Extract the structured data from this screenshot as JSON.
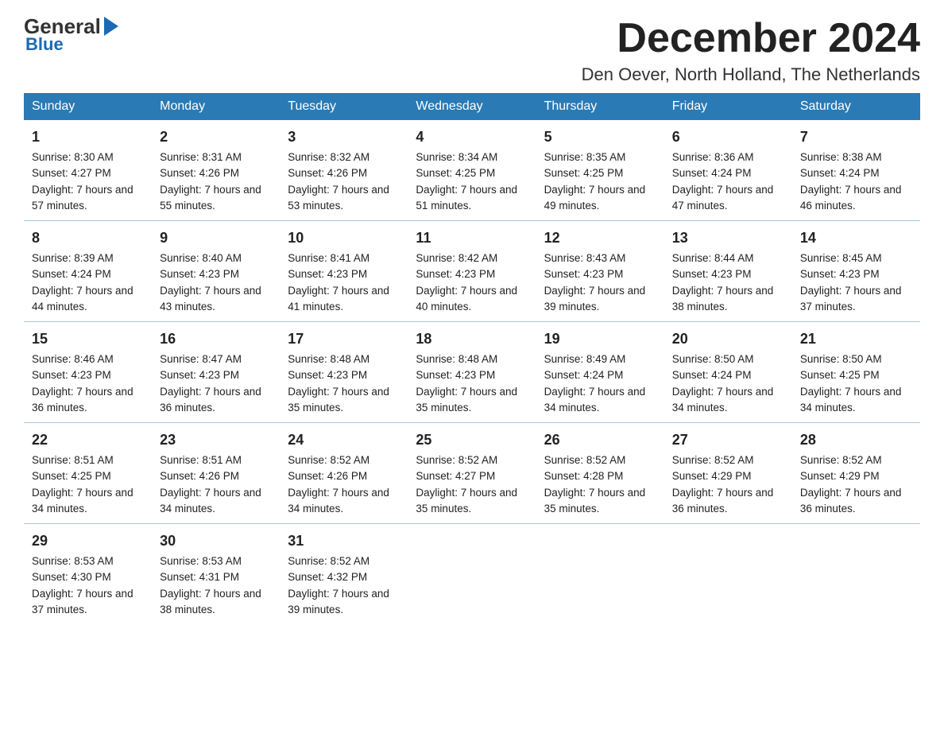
{
  "logo": {
    "text1": "General",
    "text2": "Blue"
  },
  "title": "December 2024",
  "subtitle": "Den Oever, North Holland, The Netherlands",
  "headers": [
    "Sunday",
    "Monday",
    "Tuesday",
    "Wednesday",
    "Thursday",
    "Friday",
    "Saturday"
  ],
  "weeks": [
    [
      {
        "day": "1",
        "sunrise": "8:30 AM",
        "sunset": "4:27 PM",
        "daylight": "7 hours and 57 minutes."
      },
      {
        "day": "2",
        "sunrise": "8:31 AM",
        "sunset": "4:26 PM",
        "daylight": "7 hours and 55 minutes."
      },
      {
        "day": "3",
        "sunrise": "8:32 AM",
        "sunset": "4:26 PM",
        "daylight": "7 hours and 53 minutes."
      },
      {
        "day": "4",
        "sunrise": "8:34 AM",
        "sunset": "4:25 PM",
        "daylight": "7 hours and 51 minutes."
      },
      {
        "day": "5",
        "sunrise": "8:35 AM",
        "sunset": "4:25 PM",
        "daylight": "7 hours and 49 minutes."
      },
      {
        "day": "6",
        "sunrise": "8:36 AM",
        "sunset": "4:24 PM",
        "daylight": "7 hours and 47 minutes."
      },
      {
        "day": "7",
        "sunrise": "8:38 AM",
        "sunset": "4:24 PM",
        "daylight": "7 hours and 46 minutes."
      }
    ],
    [
      {
        "day": "8",
        "sunrise": "8:39 AM",
        "sunset": "4:24 PM",
        "daylight": "7 hours and 44 minutes."
      },
      {
        "day": "9",
        "sunrise": "8:40 AM",
        "sunset": "4:23 PM",
        "daylight": "7 hours and 43 minutes."
      },
      {
        "day": "10",
        "sunrise": "8:41 AM",
        "sunset": "4:23 PM",
        "daylight": "7 hours and 41 minutes."
      },
      {
        "day": "11",
        "sunrise": "8:42 AM",
        "sunset": "4:23 PM",
        "daylight": "7 hours and 40 minutes."
      },
      {
        "day": "12",
        "sunrise": "8:43 AM",
        "sunset": "4:23 PM",
        "daylight": "7 hours and 39 minutes."
      },
      {
        "day": "13",
        "sunrise": "8:44 AM",
        "sunset": "4:23 PM",
        "daylight": "7 hours and 38 minutes."
      },
      {
        "day": "14",
        "sunrise": "8:45 AM",
        "sunset": "4:23 PM",
        "daylight": "7 hours and 37 minutes."
      }
    ],
    [
      {
        "day": "15",
        "sunrise": "8:46 AM",
        "sunset": "4:23 PM",
        "daylight": "7 hours and 36 minutes."
      },
      {
        "day": "16",
        "sunrise": "8:47 AM",
        "sunset": "4:23 PM",
        "daylight": "7 hours and 36 minutes."
      },
      {
        "day": "17",
        "sunrise": "8:48 AM",
        "sunset": "4:23 PM",
        "daylight": "7 hours and 35 minutes."
      },
      {
        "day": "18",
        "sunrise": "8:48 AM",
        "sunset": "4:23 PM",
        "daylight": "7 hours and 35 minutes."
      },
      {
        "day": "19",
        "sunrise": "8:49 AM",
        "sunset": "4:24 PM",
        "daylight": "7 hours and 34 minutes."
      },
      {
        "day": "20",
        "sunrise": "8:50 AM",
        "sunset": "4:24 PM",
        "daylight": "7 hours and 34 minutes."
      },
      {
        "day": "21",
        "sunrise": "8:50 AM",
        "sunset": "4:25 PM",
        "daylight": "7 hours and 34 minutes."
      }
    ],
    [
      {
        "day": "22",
        "sunrise": "8:51 AM",
        "sunset": "4:25 PM",
        "daylight": "7 hours and 34 minutes."
      },
      {
        "day": "23",
        "sunrise": "8:51 AM",
        "sunset": "4:26 PM",
        "daylight": "7 hours and 34 minutes."
      },
      {
        "day": "24",
        "sunrise": "8:52 AM",
        "sunset": "4:26 PM",
        "daylight": "7 hours and 34 minutes."
      },
      {
        "day": "25",
        "sunrise": "8:52 AM",
        "sunset": "4:27 PM",
        "daylight": "7 hours and 35 minutes."
      },
      {
        "day": "26",
        "sunrise": "8:52 AM",
        "sunset": "4:28 PM",
        "daylight": "7 hours and 35 minutes."
      },
      {
        "day": "27",
        "sunrise": "8:52 AM",
        "sunset": "4:29 PM",
        "daylight": "7 hours and 36 minutes."
      },
      {
        "day": "28",
        "sunrise": "8:52 AM",
        "sunset": "4:29 PM",
        "daylight": "7 hours and 36 minutes."
      }
    ],
    [
      {
        "day": "29",
        "sunrise": "8:53 AM",
        "sunset": "4:30 PM",
        "daylight": "7 hours and 37 minutes."
      },
      {
        "day": "30",
        "sunrise": "8:53 AM",
        "sunset": "4:31 PM",
        "daylight": "7 hours and 38 minutes."
      },
      {
        "day": "31",
        "sunrise": "8:52 AM",
        "sunset": "4:32 PM",
        "daylight": "7 hours and 39 minutes."
      },
      null,
      null,
      null,
      null
    ]
  ]
}
